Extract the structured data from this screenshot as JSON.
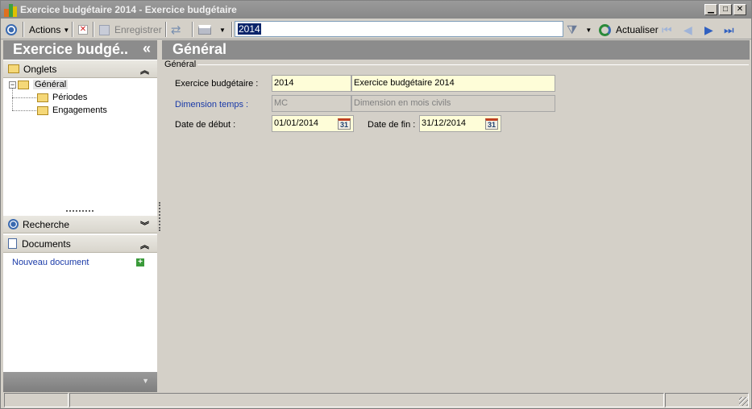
{
  "window": {
    "title": "Exercice budgétaire 2014 -  Exercice budgétaire",
    "min_glyph": "▁",
    "max_glyph": "□",
    "close_glyph": "✕"
  },
  "toolbar": {
    "actions_label": "Actions",
    "save_label": "Enregistrer",
    "search_value": "2014",
    "refresh_label": "Actualiser"
  },
  "left_panel": {
    "title": "Exercice budgé..",
    "collapse_glyph": "«",
    "tabs_group": {
      "label": "Onglets",
      "chevron": "︽"
    },
    "tree": [
      {
        "label": "Général",
        "expander": "−",
        "selected": true
      },
      {
        "label": "Périodes"
      },
      {
        "label": "Engagements"
      }
    ],
    "search_group": {
      "label": "Recherche",
      "chevron": "︾"
    },
    "documents_group": {
      "label": "Documents",
      "chevron": "︽"
    },
    "new_document_label": "Nouveau document",
    "add_glyph": "+",
    "bottom_glyph": "▼"
  },
  "main": {
    "title": "Général",
    "group_title": "Général",
    "fields": {
      "fiscal_year_label": "Exercice budgétaire :",
      "fiscal_year_code": "2014",
      "fiscal_year_name": "Exercice budgétaire 2014",
      "time_dimension_label": "Dimension temps :",
      "time_dimension_code": "MC",
      "time_dimension_name": "Dimension en mois civils",
      "start_date_label": "Date de début :",
      "start_date": "01/01/2014",
      "end_date_label": "Date de fin :",
      "end_date": "31/12/2014",
      "calendar_glyph": "31"
    }
  },
  "colors": {
    "header_gray": "#8c8c8c",
    "field_yellow": "#fefdd8",
    "link_blue": "#1a3aa8"
  }
}
